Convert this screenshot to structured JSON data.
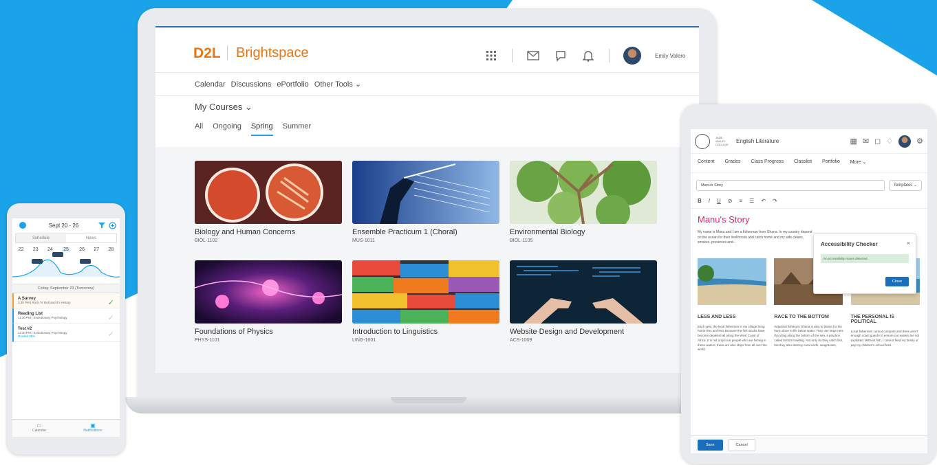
{
  "colors": {
    "accent": "#1aa3e8",
    "brand": "#e87511",
    "story_title": "#e3207a"
  },
  "laptop": {
    "brand_d2l": "D2L",
    "brand_name": "Brightspace",
    "user_name": "Emily Valero",
    "nav": [
      "Calendar",
      "Discussions",
      "ePortfolio",
      "Other Tools ⌄"
    ],
    "my_courses": "My Courses ⌄",
    "tabs": [
      "All",
      "Ongoing",
      "Spring",
      "Summer"
    ],
    "active_tab": "Spring",
    "courses": [
      {
        "title": "Biology and Human Concerns",
        "code": "BIOL-1102"
      },
      {
        "title": "Ensemble Practicum 1 (Choral)",
        "code": "MUS-1011"
      },
      {
        "title": "Environmental Biology",
        "code": "BIOL-1105"
      },
      {
        "title": "Foundations of Physics",
        "code": "PHYS-1101"
      },
      {
        "title": "Introduction to Linguistics",
        "code": "LING-1001"
      },
      {
        "title": "Website Design and Development",
        "code": "ACS-1009"
      }
    ]
  },
  "phone": {
    "week": "Sept 20 - 26",
    "seg": [
      "Schedule",
      "News"
    ],
    "days": [
      "22",
      "23",
      "24",
      "25",
      "26",
      "27",
      "28"
    ],
    "day_header": "Friday, September 23 (Tomorrow)",
    "items": [
      {
        "title": "A Survey",
        "sub": "3:30 PM | Rock 'N' Roll and It's History"
      },
      {
        "title": "Reading List",
        "sub": "11:30 PM | Evolutionary Psychology"
      },
      {
        "title": "Test #2",
        "sub": "11:30 PM | Evolutionary Psychology",
        "extra": "Graded 85%"
      }
    ],
    "bottom": [
      "Calendar",
      "Notifications"
    ]
  },
  "tablet": {
    "school": "JADE VALLEY COLLEGE",
    "course": "English Literature",
    "nav": [
      "Content",
      "Grades",
      "Class Progress",
      "Classlist",
      "Portfolio",
      "More ⌄"
    ],
    "doc_title_field": "Manu's Story",
    "templates": "Templates ⌄",
    "story_title": "Manu's Story",
    "story_text": "My name is Manu and I am a fisherman from Ghana. In my country depend on the ocean for their livelihoods and catch home and my wife cleans, smokes, preserves and...",
    "ac_title": "Accessibility Checker",
    "ac_msg": "No accessibility issues detected.",
    "ac_close": "Close",
    "columns": [
      {
        "heading": "LESS AND LESS",
        "text": "Each year, the local fishermen in my village bring home less and less because the fish stocks have become depleted all along the West Coast of Africa. It is not only local people who are fishing in these waters; there are also ships from all over the world"
      },
      {
        "heading": "RACE TO THE BOTTOM",
        "text": "Industrial fishing in Ghana is also to blame for the harm done to life below water. They use large nets that drag along the bottom of the sea, a practice called bottom trawling. Not only do they catch fish, but they also destroy coral reefs, seagrasses,"
      },
      {
        "heading": "THE PERSONAL IS POLITICAL",
        "text": "Local fishermen cannot compete and there aren't enough coast guards to ensure our waters are not exploited. Without fish, I cannot feed my family or pay my children's school fees."
      }
    ],
    "save": "Save",
    "cancel": "Cancel"
  }
}
